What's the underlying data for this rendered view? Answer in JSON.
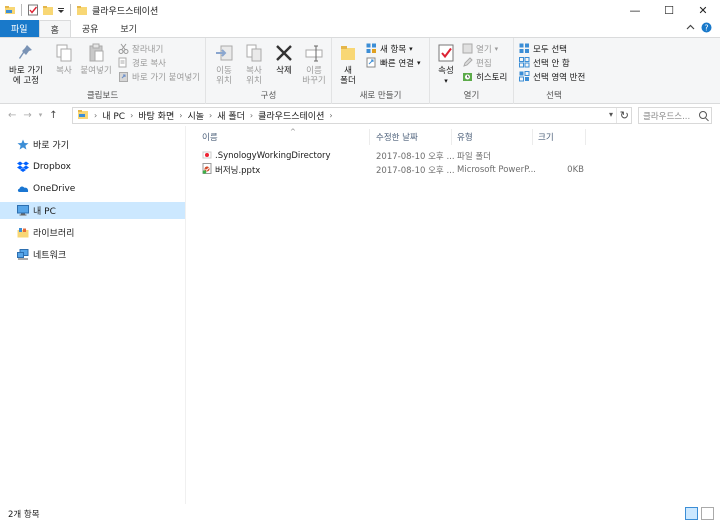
{
  "window": {
    "title": "클라우드스테이션",
    "controls": {
      "minimize": "—",
      "maximize": "☐",
      "close": "✕"
    }
  },
  "ribbon_tabs": [
    "파일",
    "홈",
    "공유",
    "보기"
  ],
  "ribbon": {
    "clipboard": {
      "label": "클립보드",
      "pin": "바로 가기에 고정",
      "copy": "복사",
      "paste": "붙여넣기",
      "cut": "잘라내기",
      "copy_path": "경로 복사",
      "paste_shortcut": "바로 가기 붙여넣기"
    },
    "organize": {
      "label": "구성",
      "move_to": "이동 위치",
      "copy_to": "복사 위치",
      "delete": "삭제",
      "rename": "이름 바꾸기"
    },
    "new": {
      "label": "새로 만들기",
      "new_folder": "새 폴더",
      "new_item": "새 항목",
      "easy_access": "빠른 연결"
    },
    "open": {
      "label": "열기",
      "properties": "속성",
      "open": "열기",
      "edit": "편집",
      "history": "히스토리"
    },
    "select": {
      "label": "선택",
      "select_all": "모두 선택",
      "select_none": "선택 안 함",
      "invert": "선택 영역 반전"
    }
  },
  "address": {
    "breadcrumbs": [
      "내 PC",
      "바탕 화면",
      "시놀",
      "새 폴더",
      "클라우드스테이션"
    ],
    "search_placeholder": "클라우드스..."
  },
  "nav_pane": [
    {
      "label": "바로 가기",
      "icon": "star-icon"
    },
    {
      "label": "Dropbox",
      "icon": "dropbox-icon"
    },
    {
      "label": "OneDrive",
      "icon": "onedrive-icon"
    },
    {
      "label": "내 PC",
      "icon": "computer-icon",
      "selected": true
    },
    {
      "label": "라이브러리",
      "icon": "library-icon"
    },
    {
      "label": "네트워크",
      "icon": "network-icon"
    }
  ],
  "columns": {
    "name": "이름",
    "date": "수정한 날짜",
    "type": "유형",
    "size": "크기"
  },
  "files": [
    {
      "name": ".SynologyWorkingDirectory",
      "date": "2017-08-10 오후 ...",
      "type": "파일 폴더",
      "size": ""
    },
    {
      "name": "버저닝.pptx",
      "date": "2017-08-10 오후 ...",
      "type": "Microsoft PowerP...",
      "size": "0KB"
    }
  ],
  "status": {
    "item_count": "2개 항목"
  },
  "colors": {
    "file_tab": "#1979ca",
    "selection": "#cce8ff",
    "ribbon_bg": "#f5f6f7"
  }
}
